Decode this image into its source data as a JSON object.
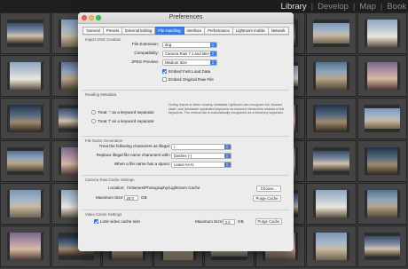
{
  "module_picker": {
    "items": [
      "Library",
      "Develop",
      "Map",
      "Book"
    ],
    "active": "Library",
    "separator": "|"
  },
  "grid": {
    "rows": [
      [
        "p3",
        "p1",
        "p5",
        "p2",
        "p4",
        "p6",
        "p1",
        "p5"
      ],
      [
        "p5",
        "p2",
        "p4",
        "p1",
        "p3",
        "p5",
        "p2",
        "p4"
      ],
      [
        "p6",
        "p3",
        "p1",
        "p5",
        "p2",
        "p4",
        "p6",
        "p1"
      ],
      [
        "p2",
        "p4",
        "p6",
        "p3",
        "p1",
        "p2",
        "p3",
        "p6"
      ],
      [
        "p1",
        "p5",
        "p2",
        "p4",
        "p6",
        "p3",
        "p5",
        "p2"
      ],
      [
        "p4",
        "p6",
        "p3",
        "p1",
        "p5",
        "p4",
        "p1",
        "p3"
      ]
    ]
  },
  "prefs": {
    "title": "Preferences",
    "tabs": [
      "General",
      "Presets",
      "External Editing",
      "File Handling",
      "Interface",
      "Performance",
      "Lightroom mobile",
      "Network"
    ],
    "active_tab": "File Handling",
    "import_dng": {
      "title": "Import DNG Creation",
      "file_extension_label": "File Extension:",
      "file_extension_value": "dng",
      "compatibility_label": "Compatibility:",
      "compatibility_value": "Camera Raw 7.1 and later",
      "jpeg_preview_label": "JPEG Preview:",
      "jpeg_preview_value": "Medium Size",
      "embed_fast_load_label": "Embed Fast Load Data",
      "embed_fast_load_checked": true,
      "embed_original_label": "Embed Original Raw File",
      "embed_original_checked": false
    },
    "reading_metadata": {
      "title": "Reading Metadata",
      "option1": "Treat '.' as a keyword separator",
      "option2": "Treat '/' as a keyword separator",
      "description": "During import or when reading metadata Lightroom can recognize dot, forward slash, and backslash separated keywords as keyword hierarchies instead of flat keywords. The vertical bar is automatically recognized as a hierarchy separator."
    },
    "file_name_generation": {
      "title": "File Name Generation",
      "illegal_label": "Treat the following characters as illegal:",
      "illegal_value": "/ :",
      "replace_label": "Replace illegal file name characters with:",
      "replace_value": "Dashes (-)",
      "space_label": "When a file name has a space:",
      "space_value": "Leave As-Is"
    },
    "camera_raw_cache": {
      "title": "Camera Raw Cache Settings",
      "location_label": "Location:",
      "location_value": "/Volumes/Photography/Lightroom Cache",
      "choose_label": "Choose...",
      "max_size_label": "Maximum Size:",
      "max_size_value": "20.0",
      "unit": "GB",
      "purge_label": "Purge Cache"
    },
    "video_cache": {
      "title": "Video Cache Settings",
      "limit_label": "Limit video cache size",
      "limit_checked": true,
      "max_size_label": "Maximum Size:",
      "max_size_value": "3.0",
      "unit": "GB",
      "purge_label": "Purge Cache"
    }
  }
}
